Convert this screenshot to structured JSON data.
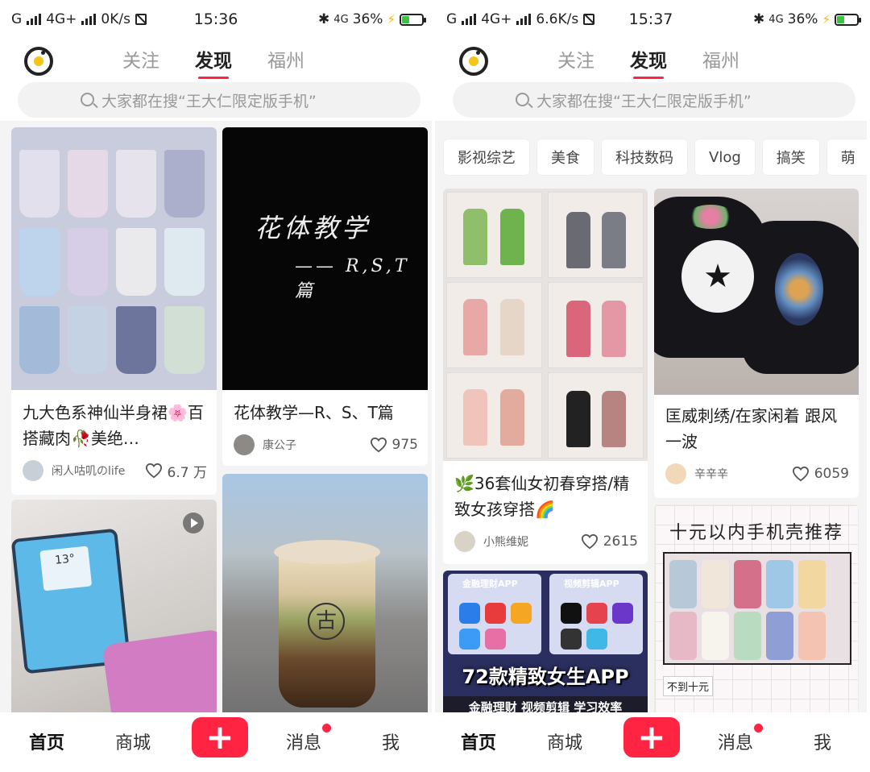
{
  "accent_color": "#ff2442",
  "screens": [
    {
      "status": {
        "signal_left": "G",
        "network": "4G+",
        "speed": "0K/s",
        "time": "15:36",
        "net_right": "4G",
        "battery": "36%"
      },
      "tabs": [
        "关注",
        "发现",
        "福州"
      ],
      "active_tab": "发现",
      "search": {
        "placeholder": "大家都在搜“王大仁限定版手机”"
      },
      "cards": [
        {
          "title": "九大色系神仙半身裙🌸百搭藏肉🥀美绝…",
          "author": "闲人咕叽のlife",
          "likes": "6.7 万",
          "image": "skirts-collage"
        },
        {
          "title": "花体教学—R、S、T篇",
          "author": "康公子",
          "likes": "975",
          "image": "calligraphy-black",
          "image_text_1": "花体教学",
          "image_text_2": "—— R,S,T 篇"
        },
        {
          "image": "tablet-phonecase",
          "is_video": true,
          "tablet_text": "13°"
        },
        {
          "image": "drink-street",
          "cup_text": "古"
        }
      ],
      "nav": {
        "home": "首页",
        "mall": "商城",
        "add": "+",
        "messages": "消息",
        "me": "我"
      }
    },
    {
      "status": {
        "signal_left": "G",
        "network": "4G+",
        "speed": "6.6K/s",
        "time": "15:37",
        "net_right": "4G",
        "battery": "36%"
      },
      "tabs": [
        "关注",
        "发现",
        "福州"
      ],
      "active_tab": "发现",
      "search": {
        "placeholder": "大家都在搜“王大仁限定版手机”"
      },
      "categories": [
        "影视综艺",
        "美食",
        "科技数码",
        "Vlog",
        "搞笑",
        "萌"
      ],
      "cards": [
        {
          "title": "🌿36套仙女初春穿搭/精致女孩穿搭🌈",
          "author": "小熊维妮",
          "likes": "2615",
          "image": "outfits-grid"
        },
        {
          "title": "匡威刺绣/在家闲着 跟风一波",
          "author": "辛辛辛",
          "likes": "6059",
          "image": "converse-embroidery"
        },
        {
          "image": "apps-collage",
          "image_title": "72款精致女生APP",
          "image_sub_1": "金融理财APP",
          "image_sub_2": "视频剪辑APP",
          "image_footer": "金融理财 视频剪辑 学习效率"
        },
        {
          "image": "phonecase-board",
          "image_title": "十元以内手机壳推荐",
          "image_sub": "不到十元"
        }
      ],
      "nav": {
        "home": "首页",
        "mall": "商城",
        "add": "+",
        "messages": "消息",
        "me": "我"
      }
    }
  ]
}
